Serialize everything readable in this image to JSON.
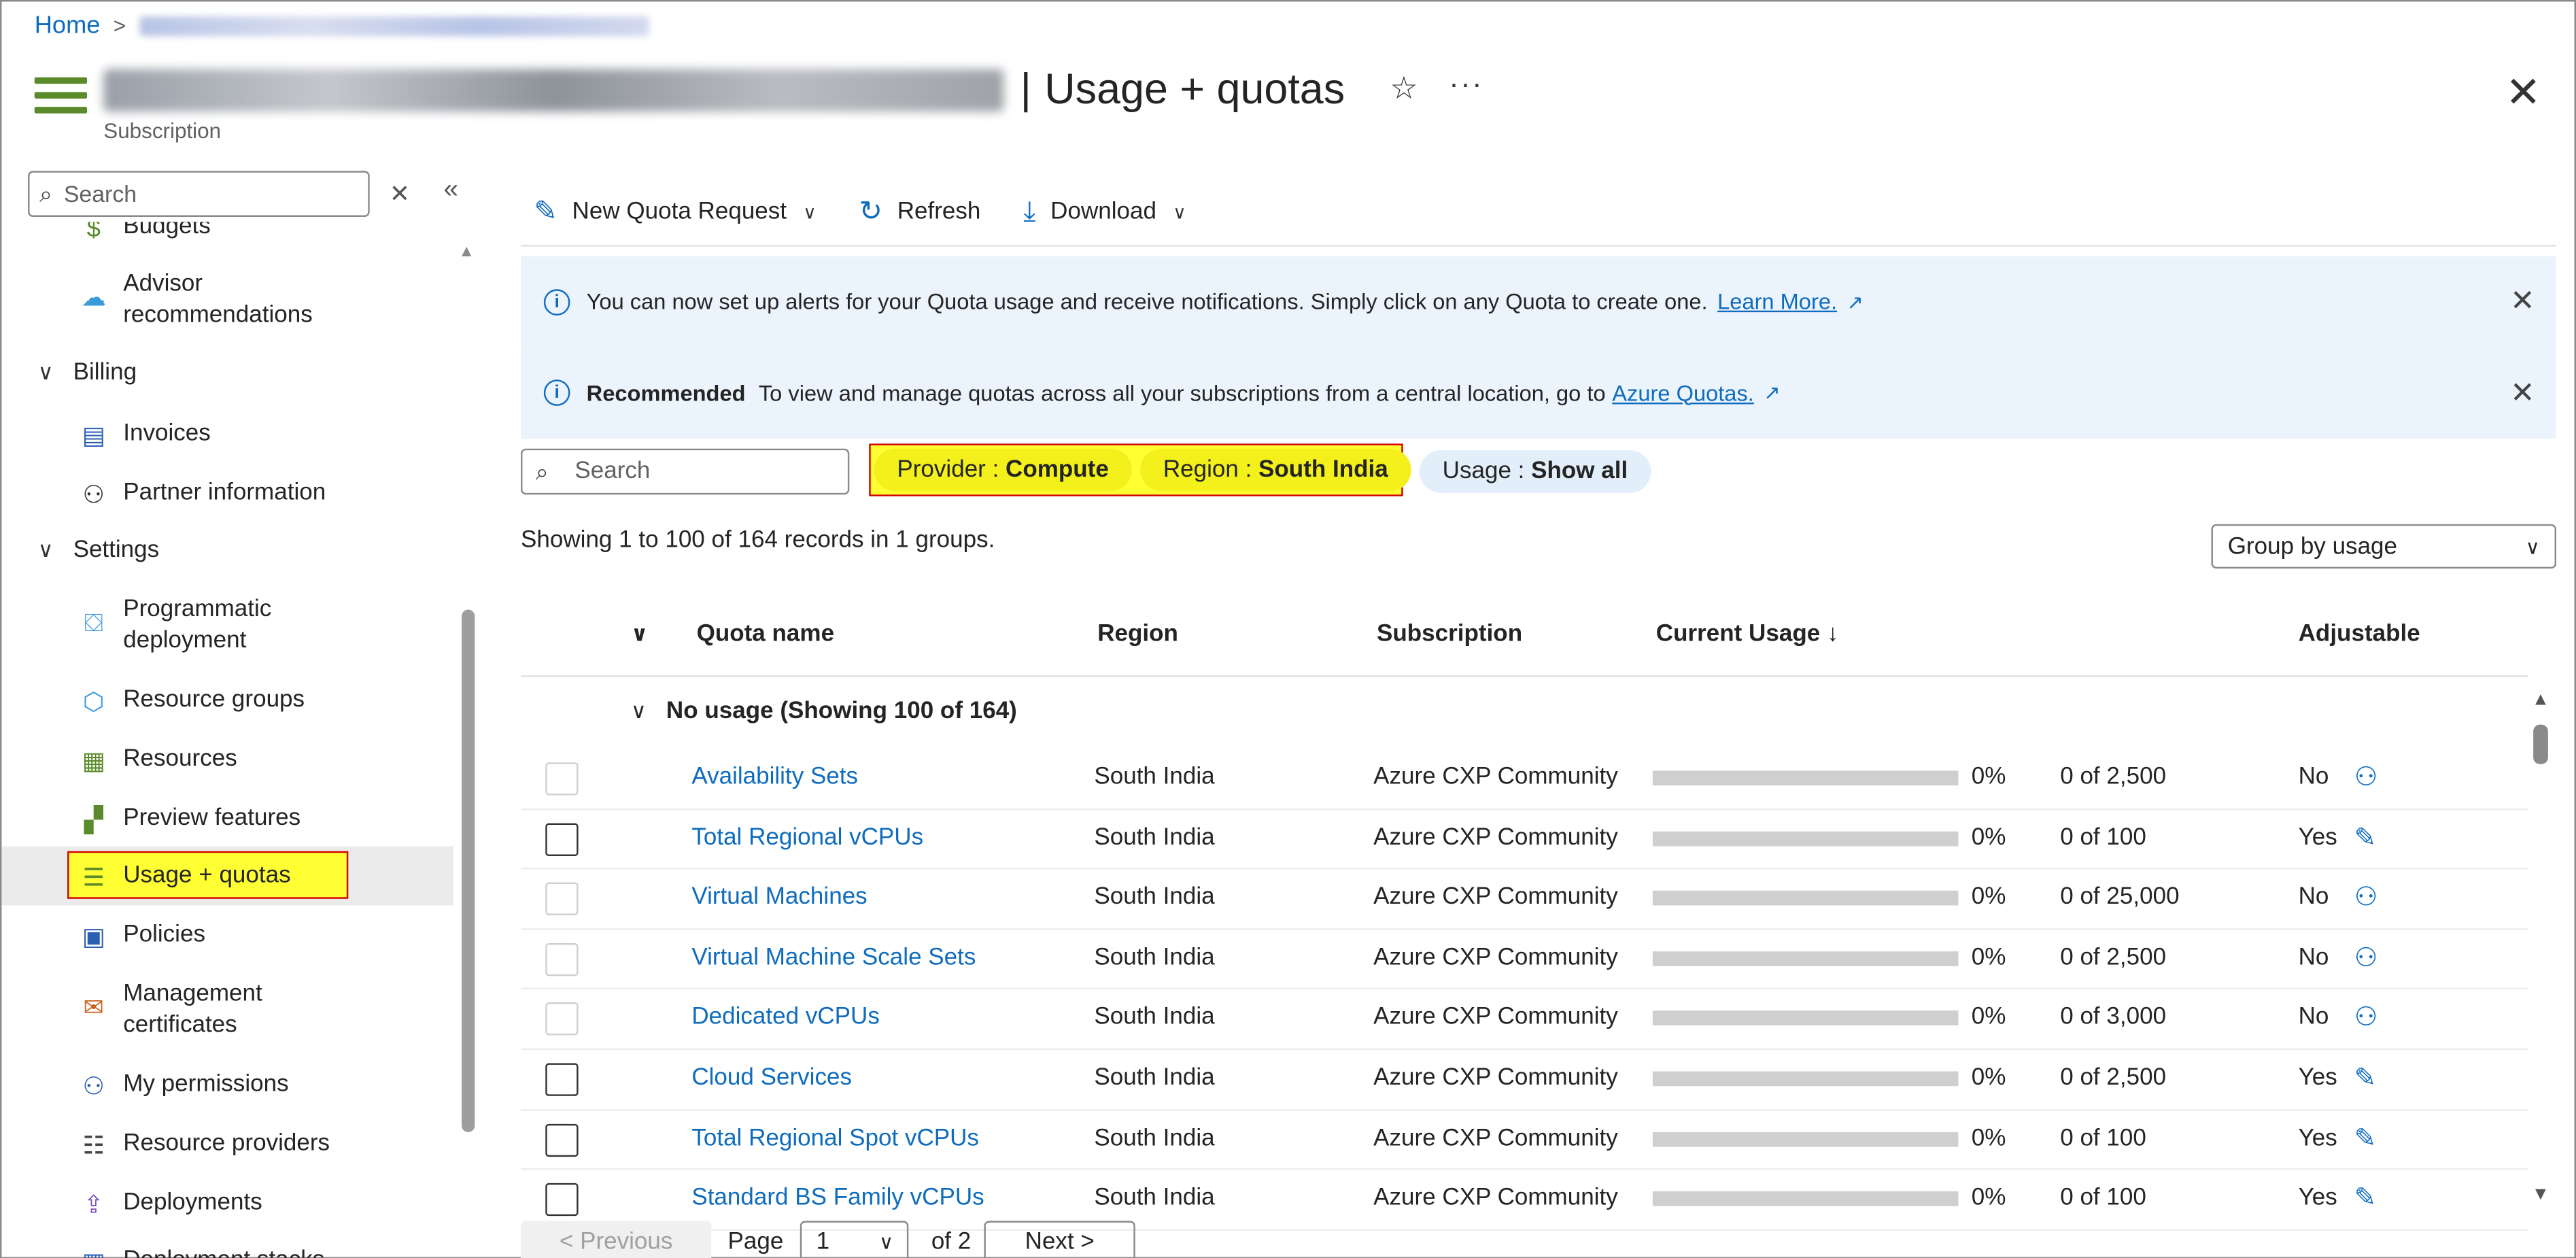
{
  "breadcrumb": {
    "home": "Home",
    "separator": ">"
  },
  "header": {
    "title": "Usage + quotas",
    "title_separator": "|",
    "subtitle": "Subscription",
    "favorite_icon": "☆",
    "more_icon": "···",
    "close_icon": "✕"
  },
  "sidebar": {
    "search_placeholder": "Search",
    "clear_icon": "✕",
    "collapse_icon": "«",
    "items": [
      {
        "label": "Budgets",
        "icon": "$"
      },
      {
        "label": "Advisor recommendations",
        "icon": "☁"
      },
      {
        "group": "Billing"
      },
      {
        "label": "Invoices",
        "icon": "▤"
      },
      {
        "label": "Partner information",
        "icon": "⚇"
      },
      {
        "group": "Settings"
      },
      {
        "label": "Programmatic deployment",
        "icon": "⛋"
      },
      {
        "label": "Resource groups",
        "icon": "⬡"
      },
      {
        "label": "Resources",
        "icon": "▦"
      },
      {
        "label": "Preview features",
        "icon": "▞"
      },
      {
        "label": "Usage + quotas",
        "icon": "☰",
        "active": true
      },
      {
        "label": "Policies",
        "icon": "▣"
      },
      {
        "label": "Management certificates",
        "icon": "✉"
      },
      {
        "label": "My permissions",
        "icon": "⚇"
      },
      {
        "label": "Resource providers",
        "icon": "☷"
      },
      {
        "label": "Deployments",
        "icon": "⇪"
      },
      {
        "label": "Deployment stacks",
        "icon": "▥"
      }
    ]
  },
  "toolbar": {
    "new_quota": "New Quota Request",
    "refresh": "Refresh",
    "download": "Download"
  },
  "banners": {
    "alert_text": "You can now set up alerts for your Quota usage and receive notifications. Simply click on any Quota to create one.",
    "alert_link": "Learn More.",
    "recommended_label": "Recommended",
    "recommended_text": "To view and manage quotas across all your subscriptions from a central location, go to",
    "recommended_link": "Azure Quotas."
  },
  "filters": {
    "search_placeholder": "Search",
    "provider_key": "Provider :",
    "provider_value": "Compute",
    "region_key": "Region :",
    "region_value": "South India",
    "usage_key": "Usage :",
    "usage_value": "Show all"
  },
  "records_text": "Showing 1 to 100 of 164 records in 1 groups.",
  "group_by": "Group by usage",
  "table": {
    "columns": {
      "quota_name": "Quota name",
      "region": "Region",
      "subscription": "Subscription",
      "current_usage": "Current Usage ↓",
      "adjustable": "Adjustable"
    },
    "group_label": "No usage (Showing 100 of 164)",
    "rows": [
      {
        "name": "Availability Sets",
        "region": "South India",
        "subscription": "Azure CXP Community",
        "percent": "0%",
        "limit": "0 of 2,500",
        "adjustable": "No",
        "action_icon": "person-icon",
        "checkbox_disabled": true
      },
      {
        "name": "Total Regional vCPUs",
        "region": "South India",
        "subscription": "Azure CXP Community",
        "percent": "0%",
        "limit": "0 of 100",
        "adjustable": "Yes",
        "action_icon": "pencil-icon",
        "checkbox_disabled": false
      },
      {
        "name": "Virtual Machines",
        "region": "South India",
        "subscription": "Azure CXP Community",
        "percent": "0%",
        "limit": "0 of 25,000",
        "adjustable": "No",
        "action_icon": "person-icon",
        "checkbox_disabled": true
      },
      {
        "name": "Virtual Machine Scale Sets",
        "region": "South India",
        "subscription": "Azure CXP Community",
        "percent": "0%",
        "limit": "0 of 2,500",
        "adjustable": "No",
        "action_icon": "person-icon",
        "checkbox_disabled": true
      },
      {
        "name": "Dedicated vCPUs",
        "region": "South India",
        "subscription": "Azure CXP Community",
        "percent": "0%",
        "limit": "0 of 3,000",
        "adjustable": "No",
        "action_icon": "person-icon",
        "checkbox_disabled": true
      },
      {
        "name": "Cloud Services",
        "region": "South India",
        "subscription": "Azure CXP Community",
        "percent": "0%",
        "limit": "0 of 2,500",
        "adjustable": "Yes",
        "action_icon": "pencil-icon",
        "checkbox_disabled": false
      },
      {
        "name": "Total Regional Spot vCPUs",
        "region": "South India",
        "subscription": "Azure CXP Community",
        "percent": "0%",
        "limit": "0 of 100",
        "adjustable": "Yes",
        "action_icon": "pencil-icon",
        "checkbox_disabled": false
      },
      {
        "name": "Standard BS Family vCPUs",
        "region": "South India",
        "subscription": "Azure CXP Community",
        "percent": "0%",
        "limit": "0 of 100",
        "adjustable": "Yes",
        "action_icon": "pencil-icon",
        "checkbox_disabled": false
      }
    ]
  },
  "pagination": {
    "previous": "< Previous",
    "page_label": "Page",
    "current_page": "1",
    "of_pages": "of 2",
    "next": "Next >"
  },
  "colors": {
    "accent": "#0f6cbd",
    "highlight": "#ffff33",
    "highlight_border": "#d00000",
    "banner_bg": "#ebf3fc"
  }
}
